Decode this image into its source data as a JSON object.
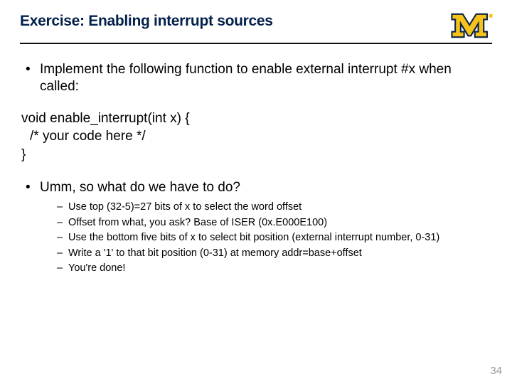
{
  "header": {
    "title": "Exercise: Enabling interrupt sources",
    "logo_name": "block-m-logo"
  },
  "bullets": {
    "b1": "Implement the following function to enable external interrupt #x when called:"
  },
  "code": {
    "l1": "void enable_interrupt(int x) {",
    "l2": "/* your code here */",
    "l3": "}"
  },
  "bullets2": {
    "q": "Umm, so what do we have to do?",
    "s1": "Use top (32-5)=27 bits of x to select the word offset",
    "s2": "Offset from what, you ask?  Base of ISER (0x.E000E100)",
    "s3": "Use the bottom five bits of x to select bit position (external interrupt number, 0-31)",
    "s4": "Write a '1' to that bit position (0-31) at memory addr=base+offset",
    "s5": "You're done!"
  },
  "page_number": "34"
}
